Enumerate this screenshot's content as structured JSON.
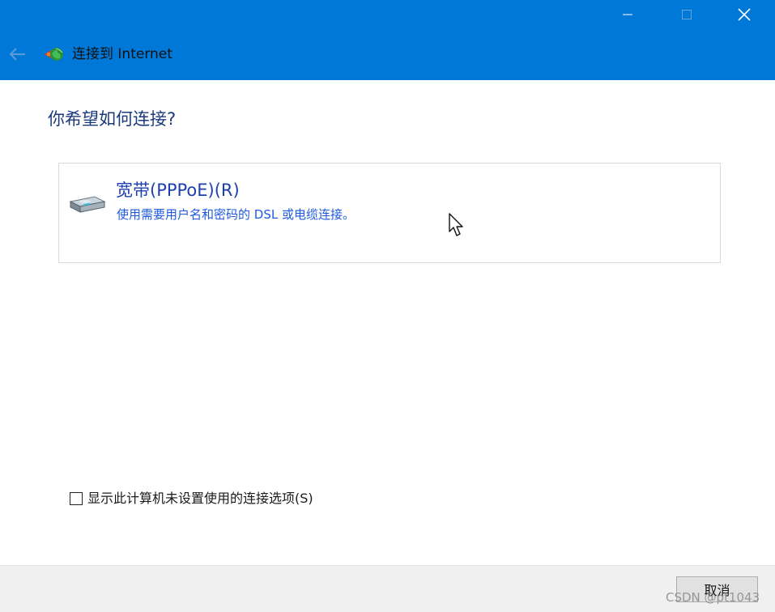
{
  "window": {
    "title": "连接到 Internet",
    "accent_color": "#0078d7",
    "controls": [
      "minimize-icon",
      "maximize-icon",
      "close-icon"
    ]
  },
  "heading": "你希望如何连接?",
  "options": [
    {
      "title": "宽带(PPPoE)(R)",
      "description": "使用需要用户名和密码的 DSL 或电缆连接。",
      "icon": "broadband-modem-icon"
    }
  ],
  "checkbox": {
    "label": "显示此计算机未设置使用的连接选项(S)",
    "checked": false
  },
  "footer": {
    "cancel_label": "取消"
  },
  "watermark": "CSDN @pt1043"
}
